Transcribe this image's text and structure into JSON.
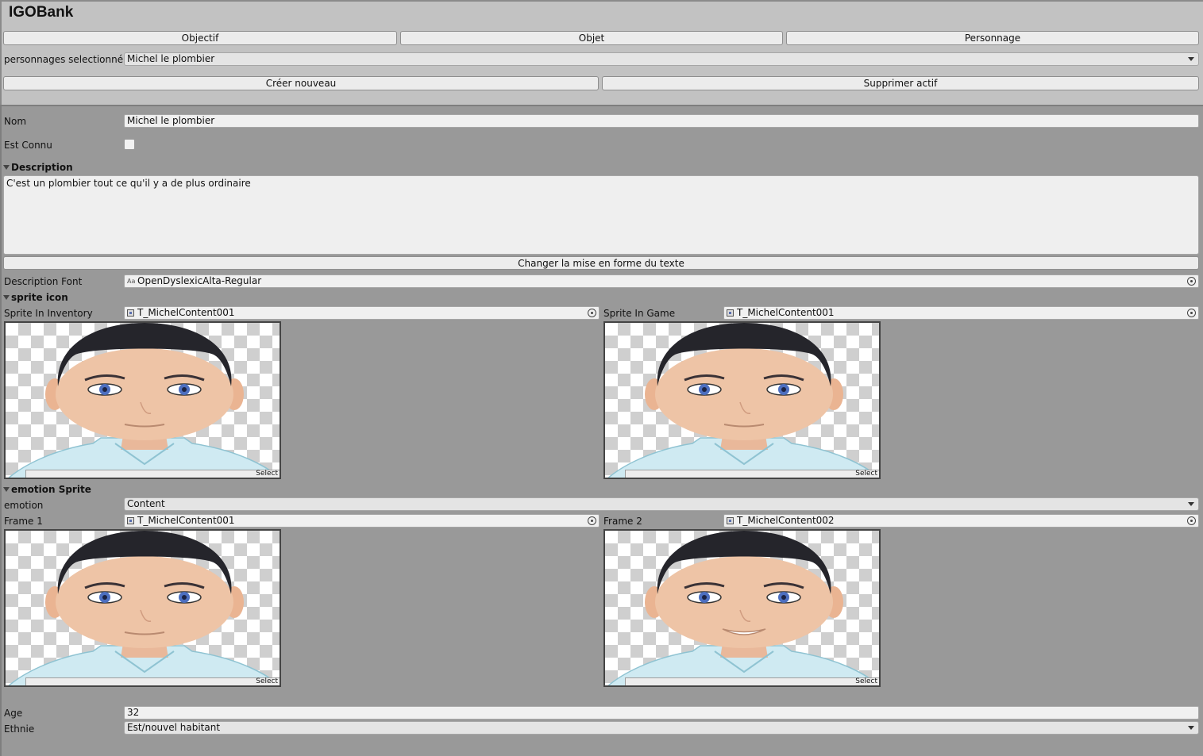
{
  "window": {
    "title": "IGOBank"
  },
  "tabs": [
    {
      "label": "Objectif"
    },
    {
      "label": "Objet"
    },
    {
      "label": "Personnage"
    }
  ],
  "selection": {
    "label": "personnages selectionné",
    "value": "Michel le plombier"
  },
  "actions": {
    "create_label": "Créer nouveau",
    "delete_label": "Supprimer actif"
  },
  "character": {
    "name_label": "Nom",
    "name_value": "Michel le plombier",
    "known_label": "Est Connu",
    "known_checked": false,
    "description_header": "Description",
    "description_text": "C'est un plombier tout ce qu'il y a de plus ordinaire",
    "format_button": "Changer la mise en forme du texte",
    "font_label": "Description Font",
    "font_value": "OpenDyslexicAlta-Regular",
    "font_icon": "Aa",
    "age_label": "Age",
    "age_value": "32",
    "ethnicity_label": "Ethnie",
    "ethnicity_value": "Est/nouvel habitant"
  },
  "sprite_icon": {
    "header": "sprite icon",
    "inventory_label": "Sprite In Inventory",
    "inventory_value": "T_MichelContent001",
    "game_label": "Sprite In Game",
    "game_value": "T_MichelContent001",
    "select_label": "Select"
  },
  "emotion_sprite": {
    "header": "emotion Sprite",
    "emotion_label": "emotion",
    "emotion_value": "Content",
    "frame1_label": "Frame 1",
    "frame1_value": "T_MichelContent001",
    "frame2_label": "Frame 2",
    "frame2_value": "T_MichelContent002",
    "select_label": "Select"
  },
  "colors": {
    "panel_bg": "#999999",
    "top_panel_bg": "#c2c2c2",
    "button_bg": "#ececec",
    "hair": "#25252b",
    "skin": "#eec4a6",
    "eye": "#4d6fc0",
    "shirt": "#cfeaf2"
  }
}
